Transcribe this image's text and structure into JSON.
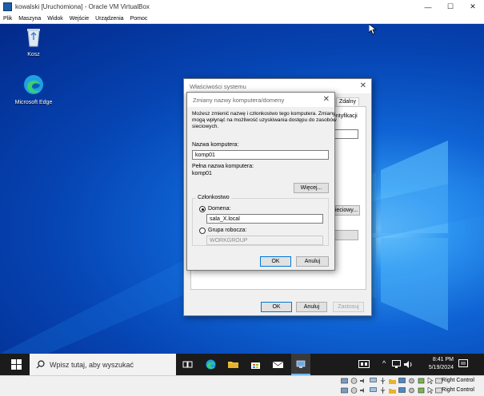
{
  "host": {
    "title": "kowalski [Uruchomiona] - Oracle VM VirtualBox",
    "controls": {
      "minimize": "—",
      "maximize": "☐",
      "close": "✕"
    },
    "menu": [
      "Plik",
      "Maszyna",
      "Widok",
      "Wejście",
      "Urządzenia",
      "Pomoc"
    ],
    "host_key_label": "Right Control"
  },
  "desktop": {
    "icons": [
      {
        "label": "Kosz",
        "icon": "recycle-bin-icon"
      },
      {
        "label": "Microsoft Edge",
        "icon": "edge-icon"
      }
    ]
  },
  "system_properties": {
    "title": "Właściwości systemu",
    "close": "✕",
    "tab_remote": "Zdalny",
    "partial_text_identification": "entyfikacji",
    "button_network": "ieciowy...",
    "button_ok": "OK",
    "button_cancel": "Anuluj",
    "button_apply": "Zastosuj"
  },
  "rename_dialog": {
    "title": "Zmiany nazwy komputera/domeny",
    "close": "✕",
    "intro_line1": "Możesz zmienić nazwę i członkostwo tego komputera. Zmiany",
    "intro_line2": "mogą wpłynąć na możliwość uzyskiwania dostępu do zasobów",
    "intro_line3": "sieciowych.",
    "computer_name_label": "Nazwa komputera:",
    "computer_name_value": "komp01",
    "full_name_label": "Pełna nazwa komputera:",
    "full_name_value": "komp01",
    "more_button": "Więcej...",
    "membership_label": "Członkostwo",
    "domain_label": "Domena:",
    "domain_value": "sala_X.local",
    "domain_selected": true,
    "workgroup_label": "Grupa robocza:",
    "workgroup_value": "WORKGROUP",
    "workgroup_selected": false,
    "ok_button": "OK",
    "cancel_button": "Anuluj"
  },
  "taskbar": {
    "search_placeholder": "Wpisz tutaj, aby wyszukać",
    "time": "8:41 PM",
    "date": "5/19/2024",
    "pinned": [
      "task-view-icon",
      "edge-icon",
      "file-explorer-icon",
      "store-icon",
      "mail-icon",
      "system-properties-icon"
    ]
  },
  "colors": {
    "desktop_bg": "#0a55c8",
    "taskbar_bg": "#1b1b1b",
    "accent": "#0078d7"
  }
}
